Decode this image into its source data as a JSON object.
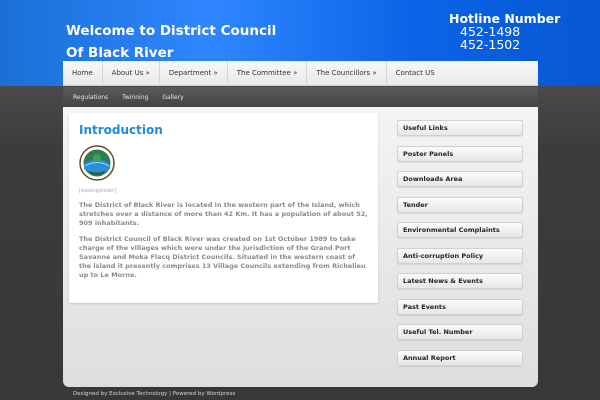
{
  "header": {
    "title_line1": "Welcome to District Council",
    "title_line2": "Of Black River",
    "hotline_title": "Hotline Number",
    "hotline_numbers": [
      "452-1498",
      "452-1502"
    ]
  },
  "nav": {
    "items": [
      {
        "label": "Home"
      },
      {
        "label": "About Us »"
      },
      {
        "label": "Department »"
      },
      {
        "label": "The Committee »"
      },
      {
        "label": "The Councillors »"
      },
      {
        "label": "Contact US"
      }
    ]
  },
  "subnav": {
    "items": [
      {
        "label": "Regulations"
      },
      {
        "label": "Twinning"
      },
      {
        "label": "Gallery"
      }
    ]
  },
  "main": {
    "heading": "Introduction",
    "slider_tag": "[easingslider]",
    "paragraphs": [
      "The District of Black River is located in the western part of the Island, which stretches over a distance of more than 42 Km. It has a population of about 52, 909 inhabitants.",
      "The District Council of Black River was created on 1st October 1989 to take charge of the villages which were under the jurisdiction of the Grand Port Savanne and Moka Flacq District Councils. Situated in the western coast of the island it presently comprises 13 Village Councils extending from Richelieu  up to Le Morne."
    ]
  },
  "sidebar": {
    "items": [
      {
        "label": "Useful Links"
      },
      {
        "label": "Poster Panels"
      },
      {
        "label": "Downloads Area"
      },
      {
        "label": "Tender"
      },
      {
        "label": "Environmental Complaints"
      },
      {
        "label": "Anti-corruption Policy"
      },
      {
        "label": "Latest News & Events"
      },
      {
        "label": "Past Events"
      },
      {
        "label": "Useful Tel. Number"
      },
      {
        "label": "Annual Report"
      }
    ]
  },
  "footer": {
    "text": "Designed by Exclusive Technology | Powered by Wordpress"
  },
  "colors": {
    "header_blue": "#1a6fd6",
    "heading_blue": "#1d8be0",
    "background_dark": "#3a3a3a"
  }
}
